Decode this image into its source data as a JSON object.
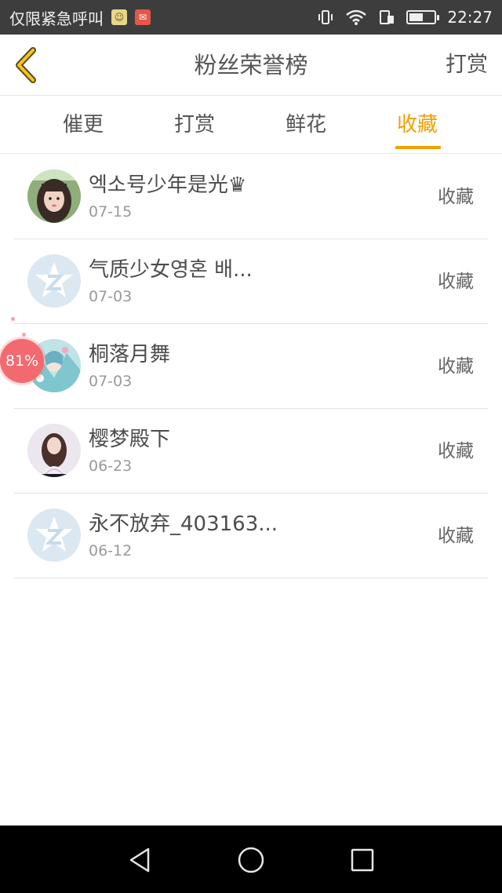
{
  "status_bar": {
    "carrier": "仅限紧急呼叫",
    "time": "22:27",
    "battery_level": 0.55,
    "notification_icons": [
      "chat-icon",
      "mail-icon"
    ],
    "system_icons": [
      "vibrate-icon",
      "wifi-icon",
      "sim-icon",
      "battery-icon"
    ]
  },
  "header": {
    "title": "粉丝荣誉榜",
    "action_label": "打赏",
    "back_icon": "chevron-left-icon"
  },
  "tabs": [
    {
      "label": "催更",
      "active": false
    },
    {
      "label": "打赏",
      "active": false
    },
    {
      "label": "鲜花",
      "active": false
    },
    {
      "label": "收藏",
      "active": true
    }
  ],
  "list": [
    {
      "name": "엑소号少年是光♛",
      "date": "07-15",
      "action": "收藏",
      "avatar": "photo-avatar"
    },
    {
      "name": "气质少女영혼 배...",
      "date": "07-03",
      "action": "收藏",
      "avatar": "default-qq-avatar"
    },
    {
      "name": "桐落月舞",
      "date": "07-03",
      "action": "收藏",
      "avatar": "anime-avatar"
    },
    {
      "name": "樱梦殿下",
      "date": "06-23",
      "action": "收藏",
      "avatar": "photo-avatar"
    },
    {
      "name": "永不放弃_403163...",
      "date": "06-12",
      "action": "收藏",
      "avatar": "default-qq-avatar"
    }
  ],
  "floating_badge": {
    "text": "81%"
  },
  "colors": {
    "accent": "#f0a000",
    "status_bar_bg": "#3d3d3d",
    "badge": "#f26a70",
    "divider": "#e3e3e3"
  }
}
